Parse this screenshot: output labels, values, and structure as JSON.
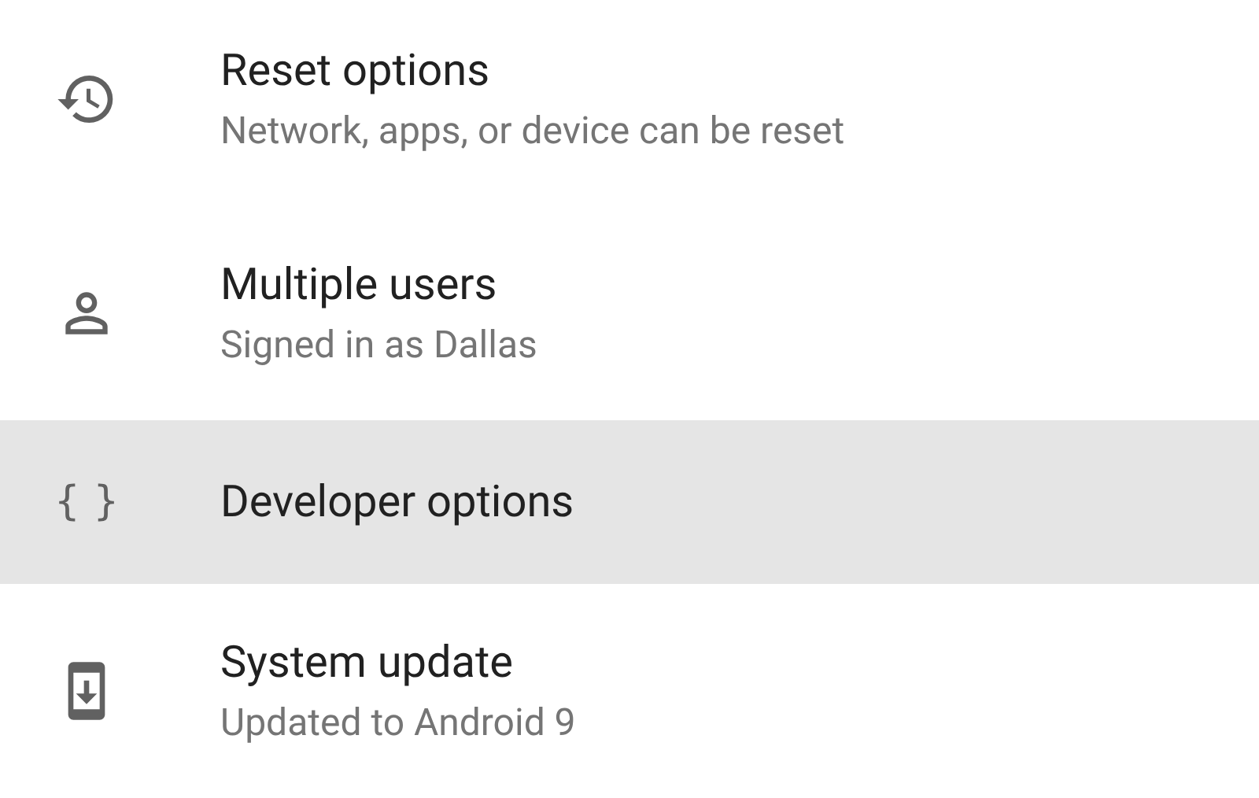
{
  "settings_items": [
    {
      "kind": "history",
      "title": "Reset options",
      "subtitle": "Network, apps, or device can be reset",
      "selected": false
    },
    {
      "kind": "person",
      "title": "Multiple users",
      "subtitle": "Signed in as Dallas",
      "selected": false
    },
    {
      "kind": "braces",
      "glyph": "{ }",
      "title": "Developer options",
      "selected": true
    },
    {
      "kind": "phone-update",
      "title": "System update",
      "subtitle": "Updated to Android 9",
      "selected": false
    }
  ]
}
